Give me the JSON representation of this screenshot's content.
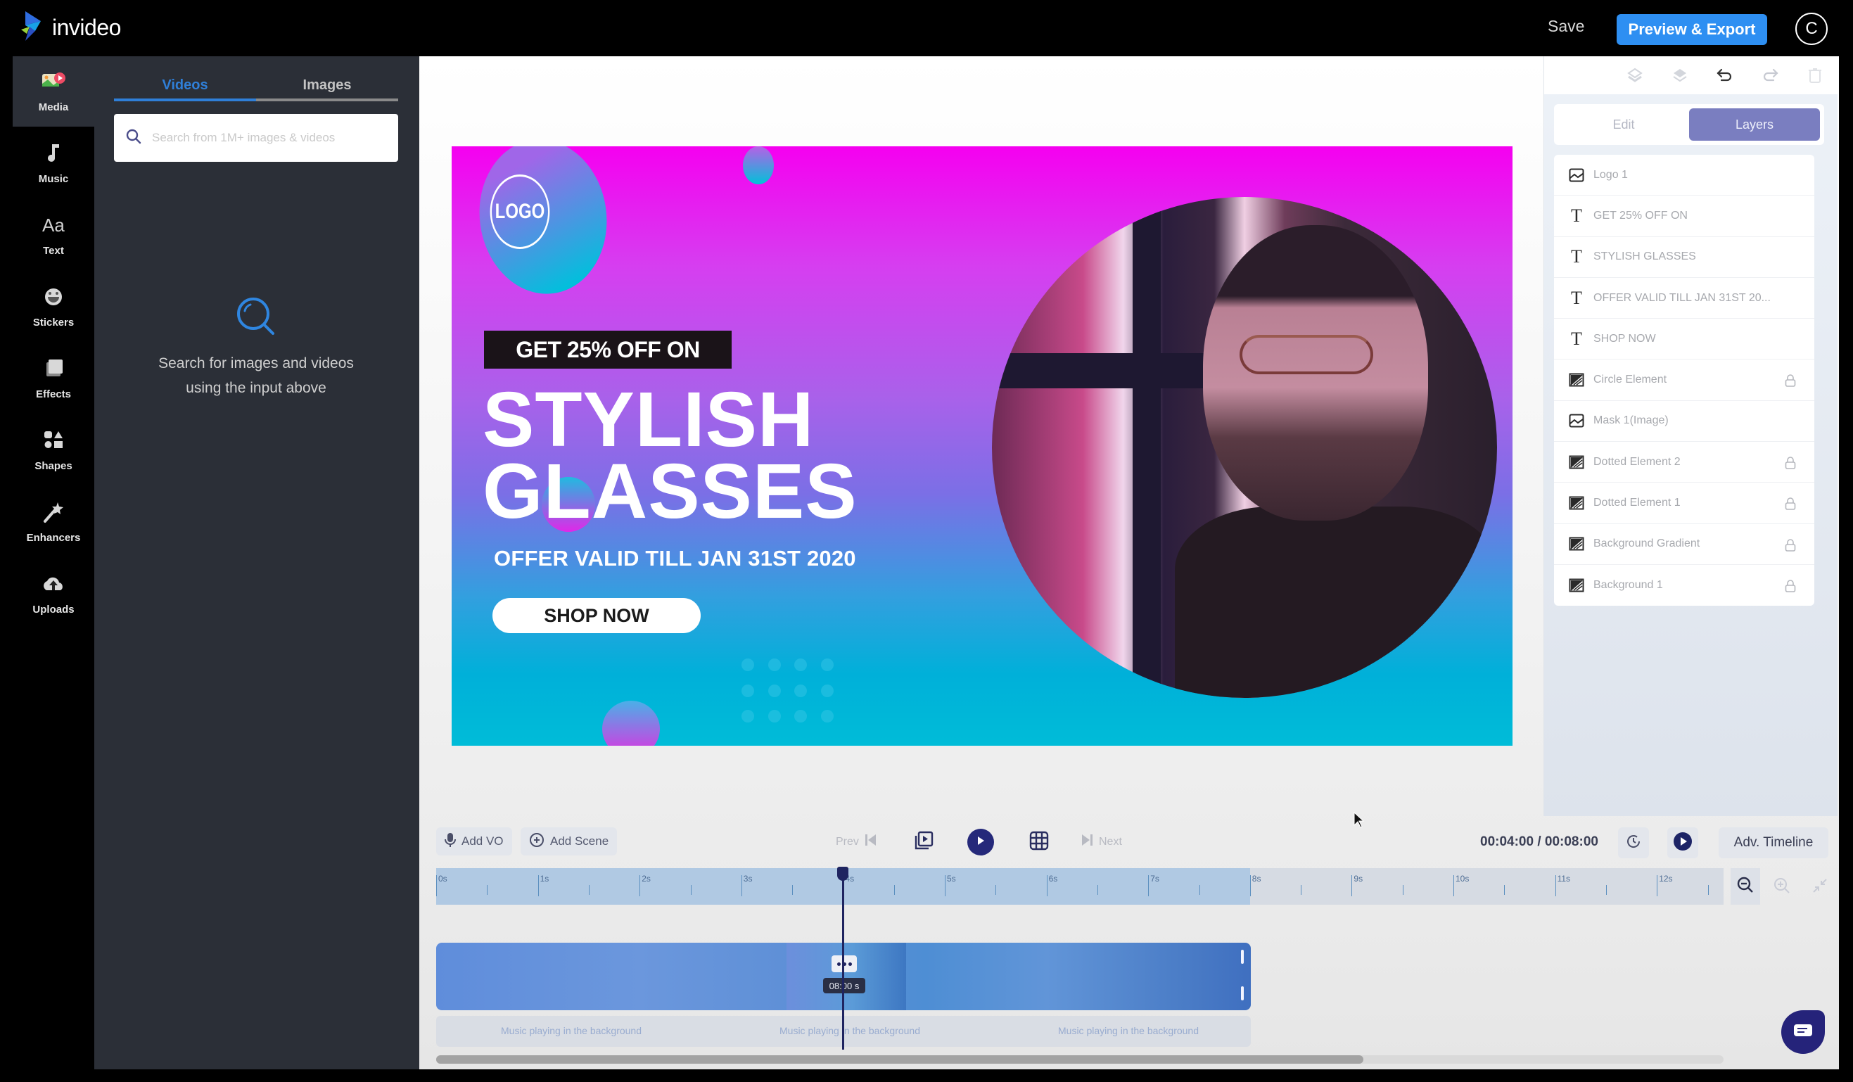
{
  "app": {
    "brand": "invideo",
    "save_label": "Save",
    "export_label": "Preview & Export",
    "avatar_initial": "C"
  },
  "sidebar": {
    "items": [
      {
        "label": "Media",
        "icon": "media-icon",
        "active": true
      },
      {
        "label": "Music",
        "icon": "music-note-icon"
      },
      {
        "label": "Text",
        "icon": "text-aa-icon"
      },
      {
        "label": "Stickers",
        "icon": "smiley-sticker-icon"
      },
      {
        "label": "Effects",
        "icon": "effects-layers-icon"
      },
      {
        "label": "Shapes",
        "icon": "shapes-icon"
      },
      {
        "label": "Enhancers",
        "icon": "magic-wand-icon"
      },
      {
        "label": "Uploads",
        "icon": "cloud-upload-icon"
      }
    ]
  },
  "media_panel": {
    "tabs": [
      {
        "label": "Videos",
        "active": true
      },
      {
        "label": "Images",
        "active": false
      }
    ],
    "search_placeholder": "Search from 1M+ images & videos",
    "search_value": "",
    "empty_line1": "Search for images and videos",
    "empty_line2": "using the input above"
  },
  "canvas": {
    "logo_text": "LOGO",
    "promo_tag": "GET 25% OFF ON",
    "headline_line1": "STYLISH",
    "headline_line2": "GLASSES",
    "offer_text": "OFFER VALID TILL JAN 31ST 2020",
    "cta_label": "SHOP NOW",
    "photo_alt": "Man with glasses by a window",
    "gradient_top": "#f500f0",
    "gradient_bottom": "#00bcd8"
  },
  "right_panel": {
    "toolbar_icons": [
      "send-backward-icon",
      "bring-forward-icon",
      "undo-icon",
      "redo-icon",
      "delete-icon"
    ],
    "segments": [
      {
        "label": "Edit",
        "active": false
      },
      {
        "label": "Layers",
        "active": true
      }
    ],
    "layers": [
      {
        "name": "Logo 1",
        "type": "image",
        "locked": false
      },
      {
        "name": "GET 25% OFF ON",
        "type": "text",
        "locked": false
      },
      {
        "name": "STYLISH GLASSES",
        "type": "text",
        "locked": false
      },
      {
        "name": "OFFER VALID TILL JAN 31ST 20...",
        "type": "text",
        "locked": false
      },
      {
        "name": "SHOP NOW",
        "type": "text",
        "locked": false
      },
      {
        "name": "Circle Element",
        "type": "shape",
        "locked": true
      },
      {
        "name": "Mask 1(Image)",
        "type": "image",
        "locked": false
      },
      {
        "name": "Dotted Element 2",
        "type": "shape",
        "locked": true
      },
      {
        "name": "Dotted Element 1",
        "type": "shape",
        "locked": true
      },
      {
        "name": "Background Gradient",
        "type": "shape",
        "locked": true
      },
      {
        "name": "Background 1",
        "type": "shape",
        "locked": true
      }
    ],
    "accent": "#7a7ec0"
  },
  "timeline": {
    "add_vo_label": "Add VO",
    "add_scene_label": "Add Scene",
    "prev_label": "Prev",
    "next_label": "Next",
    "current_time": "00:04:00",
    "total_time": "00:08:00",
    "time_separator": " / ",
    "adv_timeline_label": "Adv. Timeline",
    "ruler_labels": [
      "0s",
      "1s",
      "2s",
      "3s",
      "4s",
      "5s",
      "6s",
      "7s",
      "8s",
      "9s",
      "10s",
      "11s",
      "12s"
    ],
    "scene_duration_s": 8,
    "playhead_s": 4,
    "clip_duration_label": "08:00 s",
    "music_labels": [
      "Music playing in the background",
      "Music playing in the background",
      "Music playing in the background"
    ],
    "scroll_fraction": 0.72
  }
}
